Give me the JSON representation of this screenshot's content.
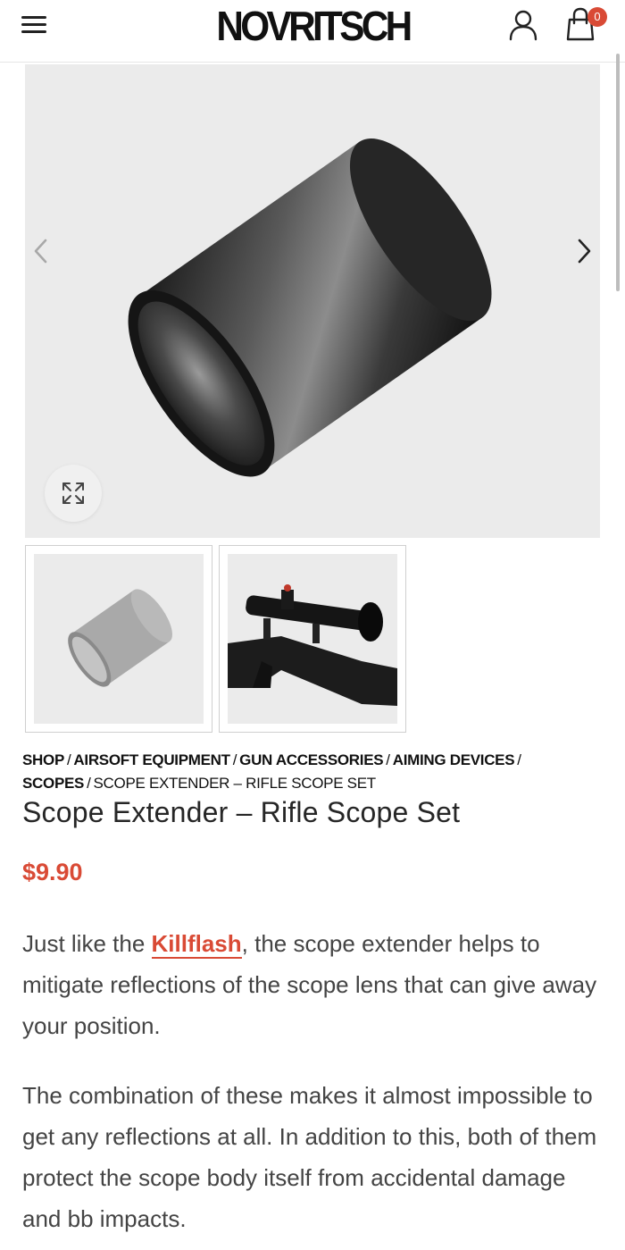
{
  "header": {
    "logo_text": "NOVRITSCH",
    "cart_count": "0"
  },
  "gallery": {
    "images": [
      "scope extender tube",
      "rifle scope set on rifle"
    ]
  },
  "breadcrumb": {
    "items": [
      "Shop",
      "Airsoft Equipment",
      "Gun Accessories",
      "Aiming Devices",
      "Scopes"
    ],
    "current": "Scope Extender – Rifle Scope Set",
    "separator": "/"
  },
  "product": {
    "title": "Scope Extender – Rifle Scope Set",
    "price": "$9.90",
    "description_1_before": "Just like the ",
    "description_1_link": "Killflash",
    "description_1_after": ", the scope extender helps to mitigate reflections of the scope lens that can give away your position.",
    "description_2": "The combination of these makes it almost impossible to get any reflections at all. In addition to this, both of them protect the scope body itself from accidental damage and bb impacts."
  },
  "colors": {
    "accent": "#d94a35",
    "text": "#444444",
    "gallery_bg": "#ebebeb"
  },
  "icons": [
    "menu-icon",
    "user-icon",
    "cart-icon",
    "chevron-left-icon",
    "chevron-right-icon",
    "expand-icon"
  ]
}
